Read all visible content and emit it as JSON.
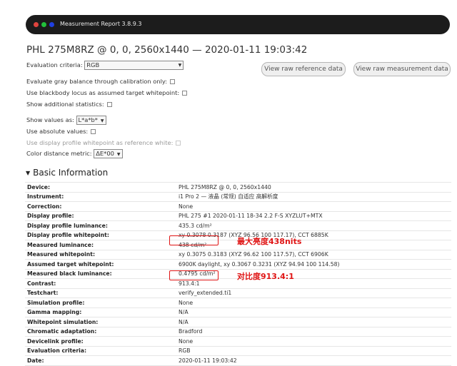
{
  "window": {
    "title": "Measurement Report 3.8.9.3"
  },
  "page": {
    "heading": "PHL 275M8RZ @ 0, 0, 2560x1440 — 2020-01-11 19:03:42"
  },
  "options": {
    "evaluation_criteria_label": "Evaluation criteria:",
    "evaluation_criteria_value": "RGB",
    "gray_balance_label": "Evaluate gray balance through calibration only:",
    "blackbody_label": "Use blackbody locus as assumed target whitepoint:",
    "additional_stats_label": "Show additional statistics:",
    "show_values_label": "Show values as:",
    "show_values_value": "L*a*b*",
    "absolute_values_label": "Use absolute values:",
    "display_profile_wp_label": "Use display profile whitepoint as reference white:",
    "color_distance_label": "Color distance metric:",
    "color_distance_value": "ΔE*00"
  },
  "buttons": {
    "raw_reference": "View raw reference data",
    "raw_measurement": "View raw measurement data"
  },
  "section": {
    "title": "Basic Information"
  },
  "rows": [
    {
      "k": "Device:",
      "v": "PHL 275M8RZ @ 0, 0, 2560x1440"
    },
    {
      "k": "Instrument:",
      "v": "i1 Pro 2 — 液晶 (常规) 自适应 高解析度"
    },
    {
      "k": "Correction:",
      "v": "None"
    },
    {
      "k": "Display profile:",
      "v": "PHL 275 #1 2020-01-11 18-34 2.2 F-S XYZLUT+MTX"
    },
    {
      "k": "Display profile luminance:",
      "v": "435.3 cd/m²"
    },
    {
      "k": "Display profile whitepoint:",
      "v": "xy 0.3078 0.3187 (XYZ 96.56 100 117.17), CCT 6885K"
    },
    {
      "k": "Measured luminance:",
      "v": "438 cd/m²"
    },
    {
      "k": "Measured whitepoint:",
      "v": "xy 0.3075 0.3183 (XYZ 96.62 100 117.57), CCT 6906K"
    },
    {
      "k": "Assumed target whitepoint:",
      "v": "6900K daylight, xy 0.3067 0.3231 (XYZ 94.94 100 114.58)"
    },
    {
      "k": "Measured black luminance:",
      "v": "0.4795 cd/m²"
    },
    {
      "k": "Contrast:",
      "v": "913.4:1"
    },
    {
      "k": "Testchart:",
      "v": "verify_extended.ti1"
    },
    {
      "k": "Simulation profile:",
      "v": "None"
    },
    {
      "k": "Gamma mapping:",
      "v": "N/A"
    },
    {
      "k": "Whitepoint simulation:",
      "v": "N/A"
    },
    {
      "k": "Chromatic adaptation:",
      "v": "Bradford"
    },
    {
      "k": "Devicelink profile:",
      "v": "None"
    },
    {
      "k": "Evaluation criteria:",
      "v": "RGB"
    },
    {
      "k": "Date:",
      "v": "2020-01-11 19:03:42"
    }
  ],
  "annotations": {
    "max_brightness": "最大亮度438nits",
    "contrast_ratio": "对比度913.4:1"
  },
  "colors": {
    "annotation": "#e01515",
    "titlebar": "#1c1c1c"
  }
}
